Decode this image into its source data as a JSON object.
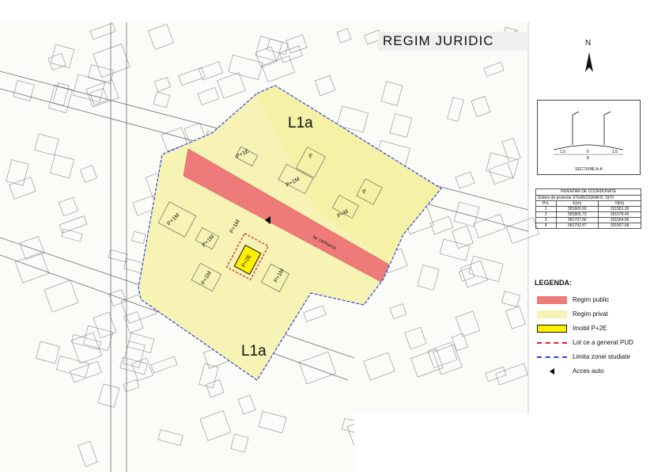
{
  "title": "REGIM  JURIDIC",
  "north": {
    "letter": "N"
  },
  "section": {
    "caption": "SECTIUNE A-A",
    "dims": [
      "1.5",
      "5",
      "1.5"
    ],
    "total": "8"
  },
  "coords": {
    "title": "INVENTAR DE COORDONATE",
    "subtitle": "Sistem de proiectie STEREOGRAFIC 1970",
    "headers": [
      "Pct.",
      "E(m)",
      "N(m)"
    ],
    "rows": [
      [
        "1",
        "581800.69",
        "331581.39"
      ],
      [
        "2",
        "581805.73",
        "331578.45"
      ],
      [
        "3",
        "581797.66",
        "331564.66"
      ],
      [
        "4",
        "581792.67",
        "331567.68"
      ]
    ]
  },
  "legend": {
    "title": "LEGENDA:",
    "items": [
      {
        "label": "Regim public",
        "color": "#ef7a7a",
        "style": "fill"
      },
      {
        "label": "Regim privat",
        "color": "#f6f3b4",
        "style": "fill"
      },
      {
        "label": "Imobil P+2E",
        "color": "#ffef00",
        "style": "box"
      },
      {
        "label": "Lot ce a generat PUD",
        "color": "#e0182a",
        "style": "dash"
      },
      {
        "label": "Limita zonei studiate",
        "color": "#2b46d6",
        "style": "dash"
      },
      {
        "label": "Acces auto",
        "color": "#000000",
        "style": "arrow"
      }
    ]
  },
  "map": {
    "zones": [
      "L1a",
      "L1a"
    ],
    "building_labels": [
      "P+1E",
      "P+1M",
      "P+1M",
      "P+M",
      "P+1M",
      "P+1M",
      "P+2E",
      "P+1M",
      "P+1M",
      "P",
      "P"
    ],
    "street_label": "Str. DERMATA",
    "colors": {
      "public": "#ef7a7a",
      "private": "#f6f3b4",
      "boundary": "#2b46d6",
      "lot": "#e0182a"
    }
  }
}
